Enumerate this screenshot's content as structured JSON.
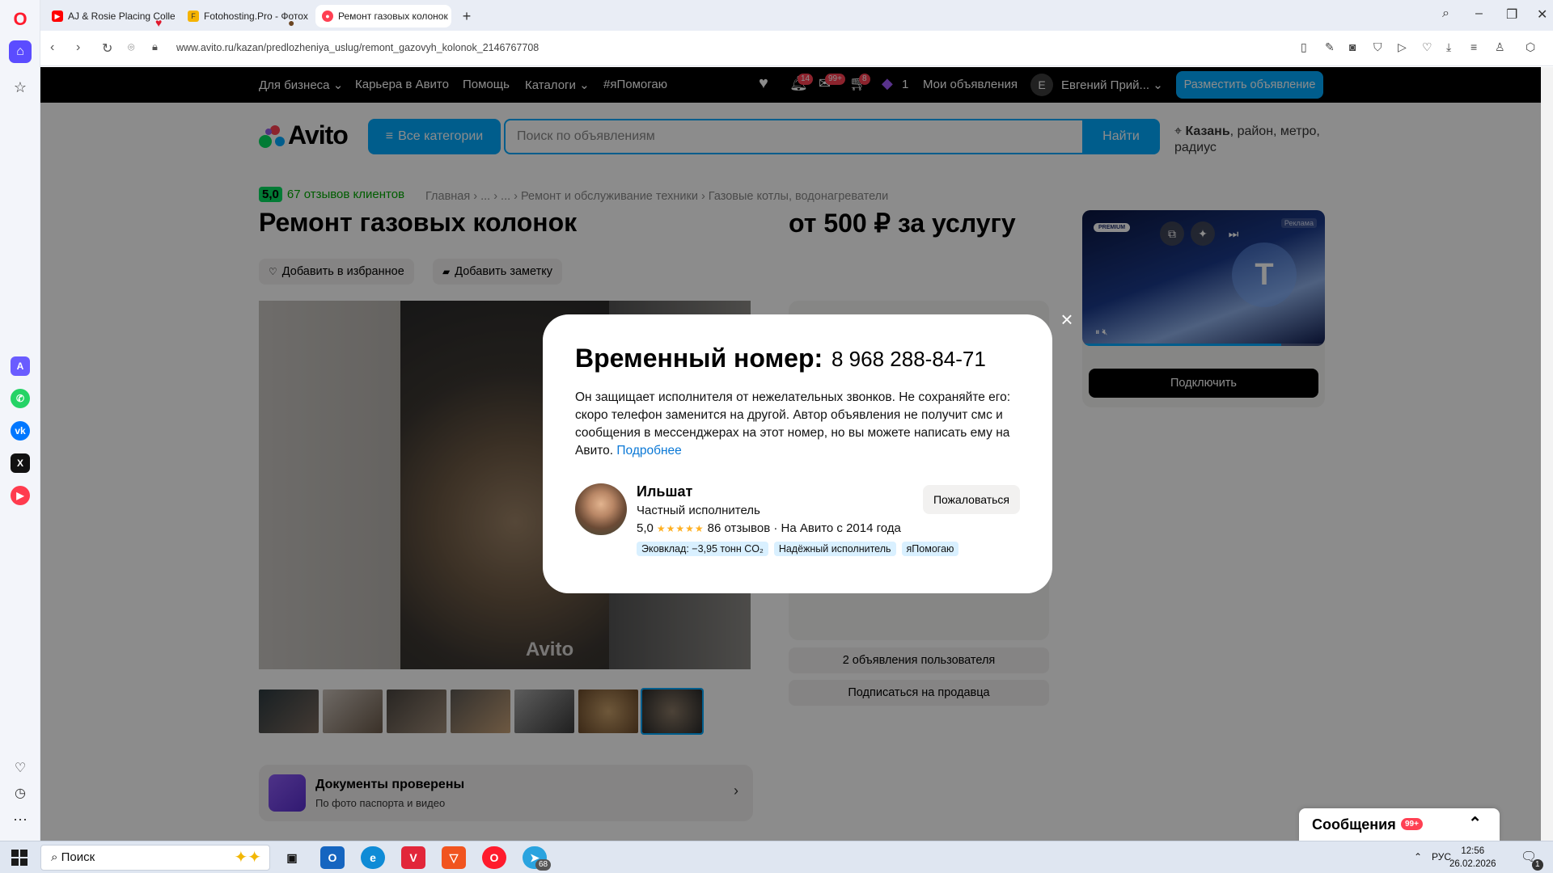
{
  "browser": {
    "tabs": [
      {
        "title": "AJ & Rosie Placing Collect"
      },
      {
        "title": "Fotohosting.Pro - Фотох"
      },
      {
        "title": "Ремонт газовых колонок"
      }
    ],
    "url": "www.avito.ru/kazan/predlozheniya_uslug/remont_gazovyh_kolonok_2146767708"
  },
  "topnav": {
    "business": "Для бизнеса",
    "career": "Карьера в Авито",
    "help": "Помощь",
    "catalogs": "Каталоги",
    "yapomogayu": "#яПомогаю",
    "badge_notifications": "14",
    "badge_messages": "99+",
    "badge_cart": "8",
    "promo_count": "1",
    "my_ads": "Мои объявления",
    "user_initial": "Е",
    "user_name": "Евгений Прий...",
    "post_ad": "Разместить объявление"
  },
  "header": {
    "logo": "Avito",
    "all_categories": "Все категории",
    "search_placeholder": "Поиск по объявлениям",
    "find": "Найти",
    "location_city": "Казань",
    "location_rest": ", район, метро, радиус"
  },
  "listing": {
    "rating": "5,0",
    "reviews": "67 отзывов клиентов",
    "breadcrumbs": "Главная › ... › ... › Ремонт и обслуживание техники › Газовые котлы, водонагреватели",
    "title": "Ремонт газовых колонок",
    "price": "от 500 ₽ за услугу",
    "add_favorite": "Добавить в избранное",
    "add_note": "Добавить заметку",
    "watermark": "Avito",
    "docs_title": "Документы проверены",
    "docs_subtitle": "По фото паспорта и видео",
    "seller_ads": "2 объявления пользователя",
    "subscribe": "Подписаться на продавца"
  },
  "ad": {
    "premium_label": "PREMIUM",
    "ad_label": "Реклама",
    "shield_letter": "T",
    "connect": "Подключить",
    "progress": 0.82
  },
  "messages": {
    "label": "Сообщения",
    "badge": "99+"
  },
  "modal": {
    "title": "Временный номер:",
    "phone": "8 968 288-84-71",
    "text": "Он защищает исполнителя от нежелательных звонков. Не сохраняйте его: скоро телефон заменится на другой. Автор объявления не получит смс и сообщения в мессенджерах на этот номер, но вы можете написать ему на Авито.",
    "more_link": "Подробнее",
    "name": "Ильшат",
    "role": "Частный исполнитель",
    "score": "5,0",
    "stars": "★★★★★",
    "reviews": "86 отзывов",
    "since": "· На Авито с 2014 года",
    "report": "Пожаловаться",
    "tags": [
      "Эковклад: −3,95 тонн CO₂",
      "Надёжный исполнитель",
      "яПомогаю"
    ]
  },
  "taskbar": {
    "search": "Поиск",
    "lang": "РУС",
    "time": "12:56",
    "date": "26.02.2026",
    "telegram_badge": "68",
    "notif_badge": "1"
  },
  "colors": {
    "accent": "#00aaff",
    "badge": "#ff4053",
    "rating_green": "#04e061"
  }
}
